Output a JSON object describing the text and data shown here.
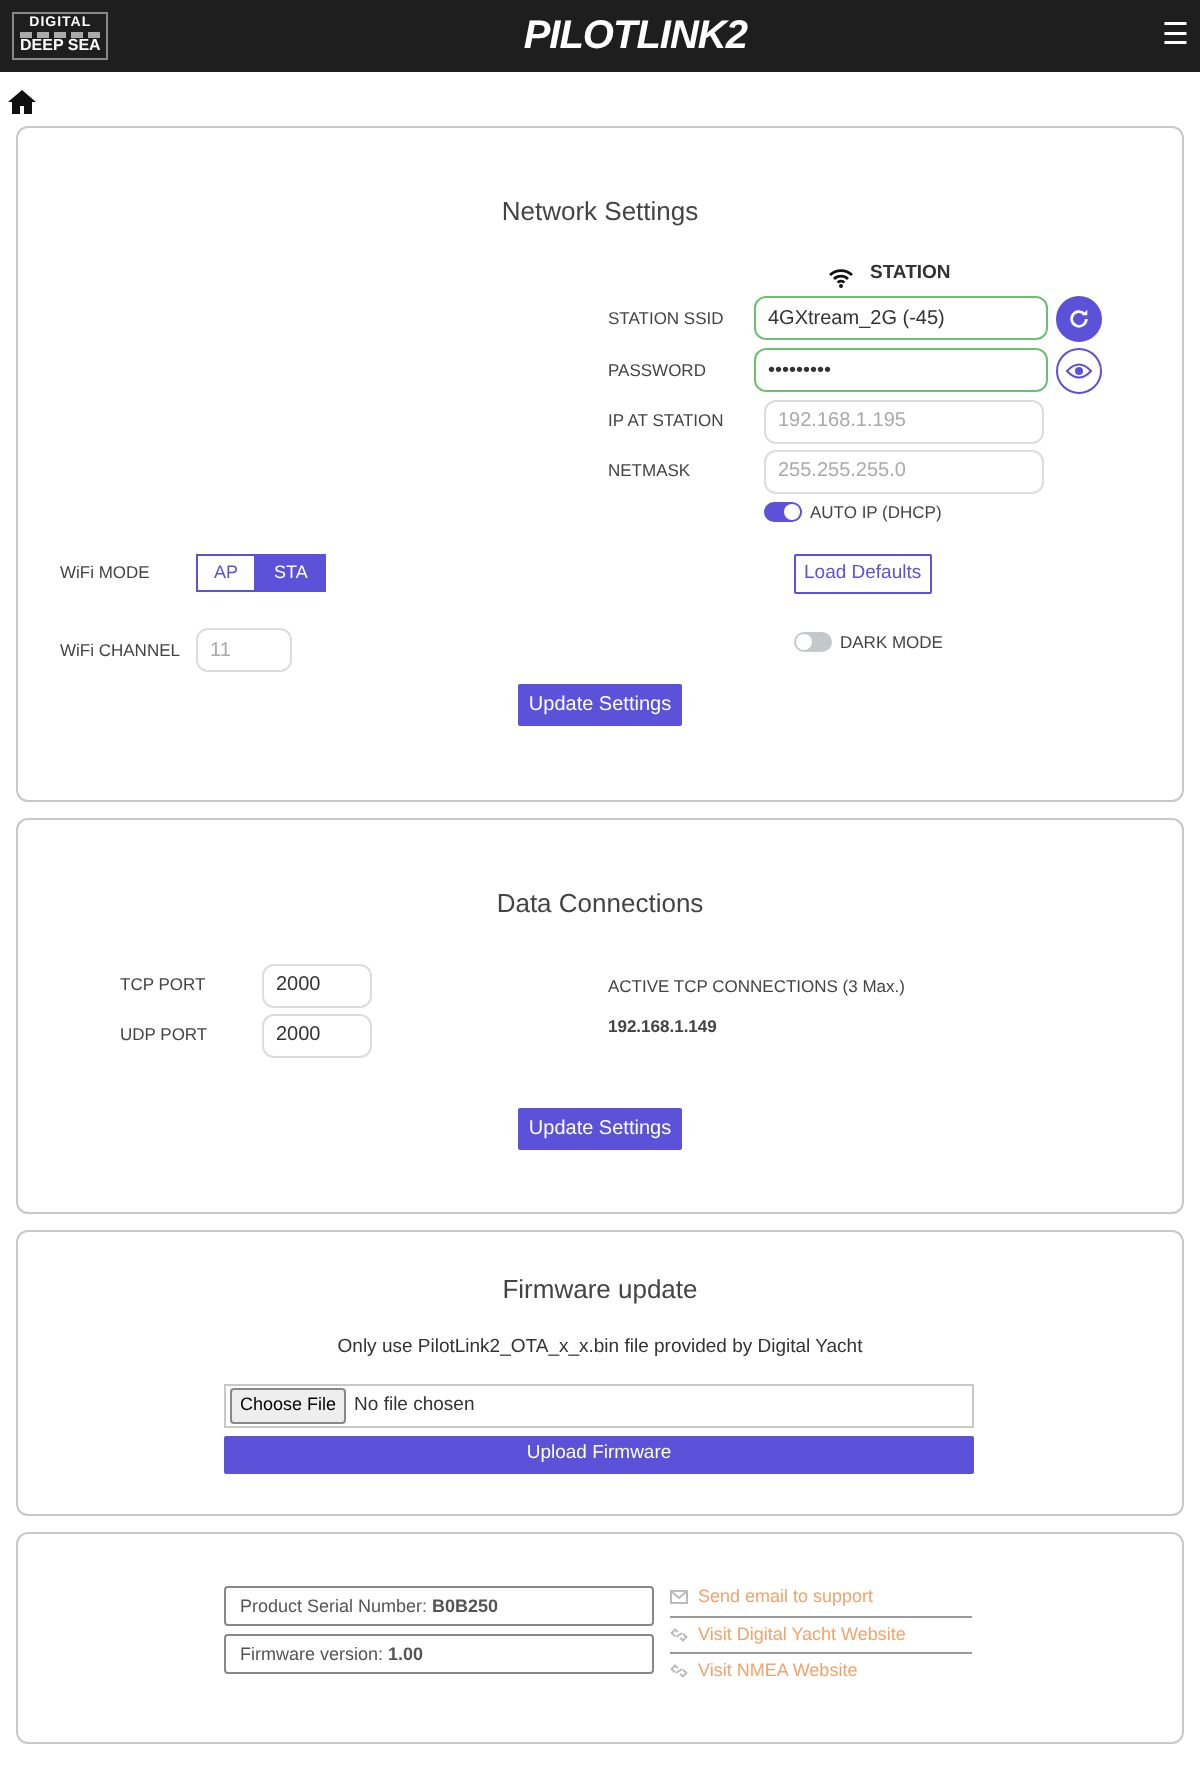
{
  "header": {
    "logo_top": "DIGITAL",
    "logo_bottom": "DEEP SEA",
    "brand": "PILOTLINK2",
    "menu": "☰"
  },
  "network": {
    "title": "Network Settings",
    "station_heading": "STATION",
    "fields": [
      {
        "label": "STATION SSID",
        "value": "4GXtream_2G (-45)",
        "valid": true,
        "disabled": false,
        "kind": "refresh"
      },
      {
        "label": "PASSWORD",
        "value": "•••••••••",
        "valid": true,
        "disabled": false,
        "kind": "reveal"
      },
      {
        "label": "IP AT STATION",
        "value": "192.168.1.195",
        "valid": false,
        "disabled": true,
        "kind": "plain"
      },
      {
        "label": "NETMASK",
        "value": "255.255.255.0",
        "valid": false,
        "disabled": true,
        "kind": "plain"
      }
    ],
    "auto_ip": {
      "label": "AUTO IP (DHCP)",
      "on": true
    },
    "wifi_mode": {
      "label": "WiFi MODE",
      "options": [
        {
          "label": "AP",
          "selected": false
        },
        {
          "label": "STA",
          "selected": true
        }
      ]
    },
    "load_defaults": "Load Defaults",
    "dark_mode": {
      "label": "DARK MODE",
      "on": false
    },
    "wifi_channel": {
      "label": "WiFi CHANNEL",
      "value": "11",
      "disabled": true
    },
    "button": "Update Settings"
  },
  "data": {
    "title": "Data Connections",
    "ports": [
      {
        "label": "TCP PORT",
        "value": "2000"
      },
      {
        "label": "UDP PORT",
        "value": "2000"
      }
    ],
    "active_heading": "ACTIVE TCP CONNECTIONS (3 Max.)",
    "connections": [
      "192.168.1.149"
    ],
    "button": "Update Settings"
  },
  "firmware": {
    "title": "Firmware update",
    "note": "Only use PilotLink2_OTA_x_x.bin file provided by Digital Yacht",
    "choose": "Choose File",
    "file_status": "No file chosen",
    "button": "Upload Firmware"
  },
  "info": {
    "lines": [
      "Product Serial Number: **B0B250**",
      "Firmware version: **1.00**"
    ],
    "links": [
      {
        "kind": "email",
        "label": "Send email to support"
      },
      {
        "kind": "link",
        "label": "Visit Digital Yacht Website"
      },
      {
        "kind": "link",
        "label": "Visit NMEA Website"
      }
    ]
  }
}
